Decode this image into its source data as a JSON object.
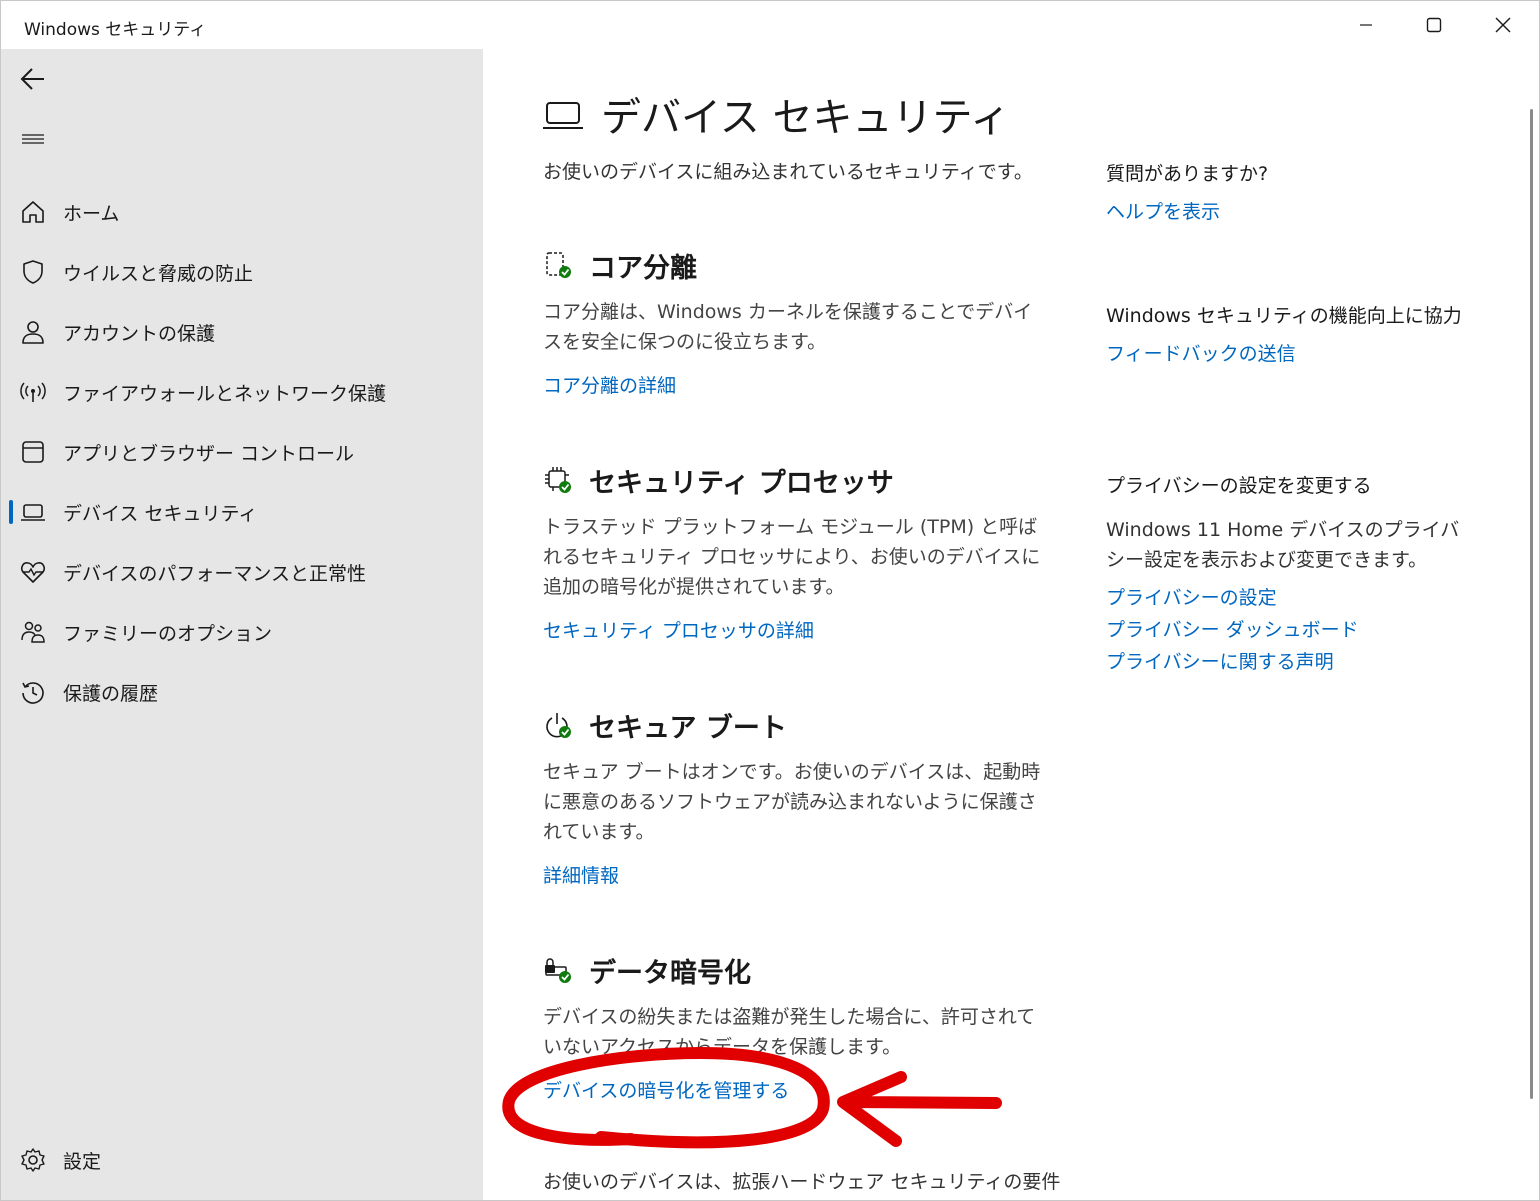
{
  "window": {
    "title": "Windows セキュリティ"
  },
  "sidebar": {
    "items": [
      {
        "label": "ホーム",
        "icon": "home-icon"
      },
      {
        "label": "ウイルスと脅威の防止",
        "icon": "shield-icon"
      },
      {
        "label": "アカウントの保護",
        "icon": "person-icon"
      },
      {
        "label": "ファイアウォールとネットワーク保護",
        "icon": "wireless-icon"
      },
      {
        "label": "アプリとブラウザー コントロール",
        "icon": "app-window-icon"
      },
      {
        "label": "デバイス セキュリティ",
        "icon": "laptop-icon",
        "active": true
      },
      {
        "label": "デバイスのパフォーマンスと正常性",
        "icon": "heart-pulse-icon"
      },
      {
        "label": "ファミリーのオプション",
        "icon": "family-icon"
      },
      {
        "label": "保護の履歴",
        "icon": "history-icon"
      }
    ],
    "settings_label": "設定"
  },
  "main": {
    "title": "デバイス セキュリティ",
    "description": "お使いのデバイスに組み込まれているセキュリティです。",
    "sections": [
      {
        "title": "コア分離",
        "text": "コア分離は、Windows カーネルを保護することでデバイスを安全に保つのに役立ちます。",
        "link": "コア分離の詳細"
      },
      {
        "title": "セキュリティ プロセッサ",
        "text": "トラステッド プラットフォーム モジュール (TPM) と呼ばれるセキュリティ プロセッサにより、お使いのデバイスに追加の暗号化が提供されています。",
        "link": "セキュリティ プロセッサの詳細"
      },
      {
        "title": "セキュア ブート",
        "text": "セキュア ブートはオンです。お使いのデバイスは、起動時に悪意のあるソフトウェアが読み込まれないように保護されています。",
        "link": "詳細情報"
      },
      {
        "title": "データ暗号化",
        "text": "デバイスの紛失または盗難が発生した場合に、許可されていないアクセスからデータを保護します。",
        "link": "デバイスの暗号化を管理する"
      }
    ],
    "footer_text": "お使いのデバイスは、拡張ハードウェア セキュリティの要件"
  },
  "aside": {
    "question": {
      "heading": "質問がありますか?",
      "link": "ヘルプを表示"
    },
    "feedback": {
      "heading": "Windows セキュリティの機能向上に協力",
      "link": "フィードバックの送信"
    },
    "privacy": {
      "heading": "プライバシーの設定を変更する",
      "text": "Windows 11 Home デバイスのプライバシー設定を表示および変更できます。",
      "links": [
        "プライバシーの設定",
        "プライバシー ダッシュボード",
        "プライバシーに関する声明"
      ]
    }
  },
  "colors": {
    "accent": "#0067c0",
    "sidebar_bg": "#e6e6e6",
    "success": "#107c10",
    "annotation": "#e00000"
  }
}
